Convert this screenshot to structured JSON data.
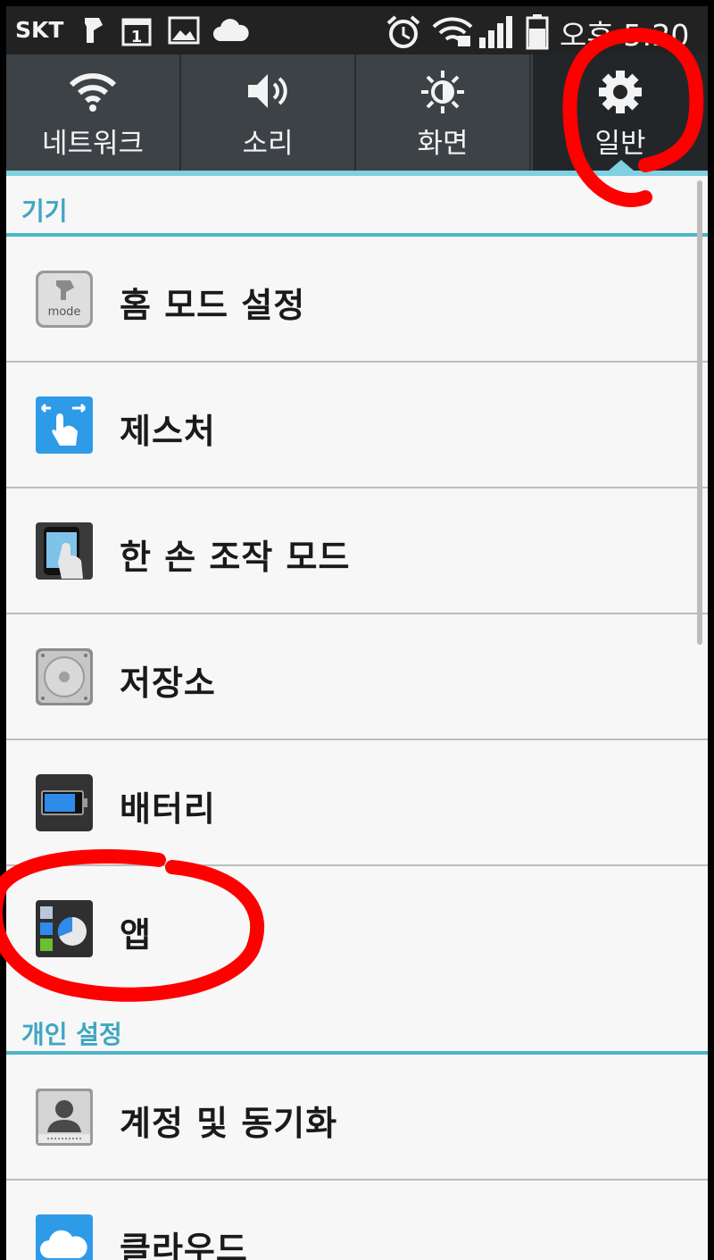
{
  "status_bar": {
    "carrier": "SKT",
    "time": "오후 5:20"
  },
  "tabs": [
    {
      "label": "네트워크",
      "icon": "wifi-icon"
    },
    {
      "label": "소리",
      "icon": "speaker-icon"
    },
    {
      "label": "화면",
      "icon": "brightness-icon"
    },
    {
      "label": "일반",
      "icon": "gear-icon",
      "active": true
    }
  ],
  "sections": [
    {
      "title": "기기"
    },
    {
      "title": "개인 설정"
    }
  ],
  "items": [
    {
      "label": "홈 모드 설정",
      "icon": "home-mode-icon"
    },
    {
      "label": "제스처",
      "icon": "gesture-icon"
    },
    {
      "label": "한 손 조작 모드",
      "icon": "one-hand-icon"
    },
    {
      "label": "저장소",
      "icon": "storage-icon"
    },
    {
      "label": "배터리",
      "icon": "battery-icon"
    },
    {
      "label": "앱",
      "icon": "apps-icon"
    },
    {
      "label": "계정 및 동기화",
      "icon": "account-icon"
    },
    {
      "label": "클라우드",
      "icon": "cloud-icon"
    }
  ],
  "colors": {
    "accent": "#4fb4c9",
    "annotation": "#ff0000"
  }
}
